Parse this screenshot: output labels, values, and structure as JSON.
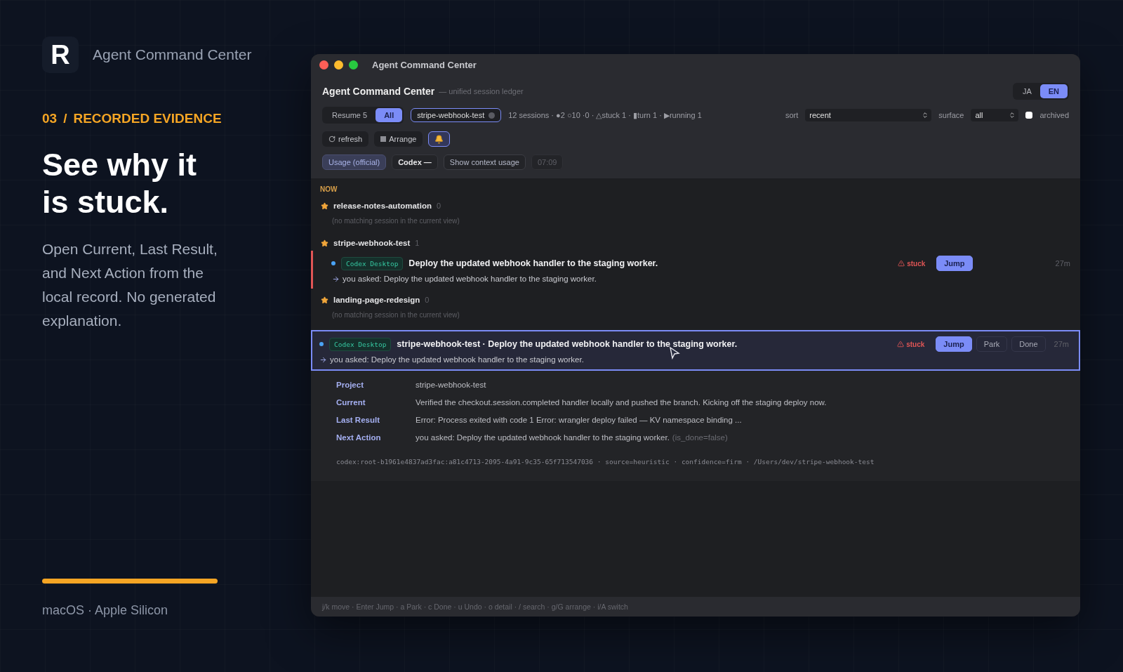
{
  "brand": {
    "logo_letter": "R",
    "title": "Agent Command Center"
  },
  "section": {
    "number": "03",
    "separator": "/",
    "label": "RECORDED EVIDENCE"
  },
  "headline": [
    "See why it",
    "is stuck."
  ],
  "description": "Open Current, Last Result, and Next Action from the local record. No generated explanation.",
  "platform": "macOS · Apple Silicon",
  "window": {
    "title": "Agent Command Center"
  },
  "header": {
    "title": "Agent Command Center",
    "subtitle": "— unified session ledger",
    "languages": [
      {
        "label": "JA",
        "selected": false
      },
      {
        "label": "EN",
        "selected": true
      }
    ]
  },
  "filters": {
    "views": [
      {
        "label": "Resume 5",
        "selected": false
      },
      {
        "label": "All",
        "selected": true
      }
    ],
    "project_filter": "stripe-webhook-test",
    "summary": "12 sessions · ●2 ○10 ·0 · △stuck 1 · ▮turn 1 · ▶running 1",
    "sort": {
      "label": "sort",
      "value": "recent"
    },
    "surface": {
      "label": "surface",
      "value": "all"
    },
    "archived": {
      "label": "archived",
      "checked": false
    }
  },
  "toolbar": [
    {
      "kind": "refresh",
      "label": "refresh",
      "active": false
    },
    {
      "kind": "arrange",
      "label": "Arrange",
      "active": false
    },
    {
      "kind": "bell",
      "active": true
    }
  ],
  "usage": [
    {
      "kind": "usage",
      "label": "Usage (official)"
    },
    {
      "kind": "provider",
      "label": "Codex —"
    },
    {
      "kind": "action",
      "label": "Show context usage"
    },
    {
      "kind": "time",
      "label": "07:09"
    }
  ],
  "group": {
    "label": "NOW",
    "projects": [
      {
        "name": "release-notes-automation",
        "count": "0",
        "starred": true,
        "empty_note": "(no matching session in the current view)"
      },
      {
        "name": "stripe-webhook-test",
        "count": "1",
        "starred": true,
        "sessions": [
          {
            "source": "Codex Desktop",
            "title": "Deploy the updated webhook handler to the staging worker.",
            "prompt": "you asked: Deploy the updated webhook handler to the staging worker.",
            "status": "stuck",
            "time": "27m",
            "actions": [
              {
                "label": "Jump",
                "primary": true
              }
            ]
          }
        ]
      },
      {
        "name": "landing-page-redesign",
        "count": "0",
        "starred": true,
        "empty_note": "(no matching session in the current view)"
      }
    ]
  },
  "selected_session": {
    "source": "Codex Desktop",
    "title": "stripe-webhook-test · Deploy the updated webhook handler to the staging worker.",
    "prompt": "you asked: Deploy the updated webhook handler to the staging worker.",
    "status": "stuck",
    "time": "27m",
    "actions": [
      {
        "label": "Jump",
        "primary": true
      },
      {
        "label": "Park",
        "primary": false
      },
      {
        "label": "Done",
        "primary": false
      }
    ]
  },
  "details": {
    "rows": [
      {
        "label": "Project",
        "value": "stripe-webhook-test"
      },
      {
        "label": "Current",
        "value": "Verified the checkout.session.completed handler locally and pushed the branch. Kicking off the staging deploy now."
      },
      {
        "label": "Last Result",
        "value": "Error: Process exited with code 1 Error: wrangler deploy failed — KV namespace binding ..."
      },
      {
        "label": "Next Action",
        "value": "you asked: Deploy the updated webhook handler to the staging worker.",
        "note": "(is_done=false)"
      }
    ],
    "meta": "codex:root-b1961e4837ad3fac:a81c4713-2095-4a91-9c35-65f713547036 · source=heuristic · confidence=firm · /Users/dev/stripe-webhook-test"
  },
  "shortcuts": "j/k move · Enter Jump · a Park · c Done · u Undo · o detail · / search · g/G arrange · i/A switch"
}
